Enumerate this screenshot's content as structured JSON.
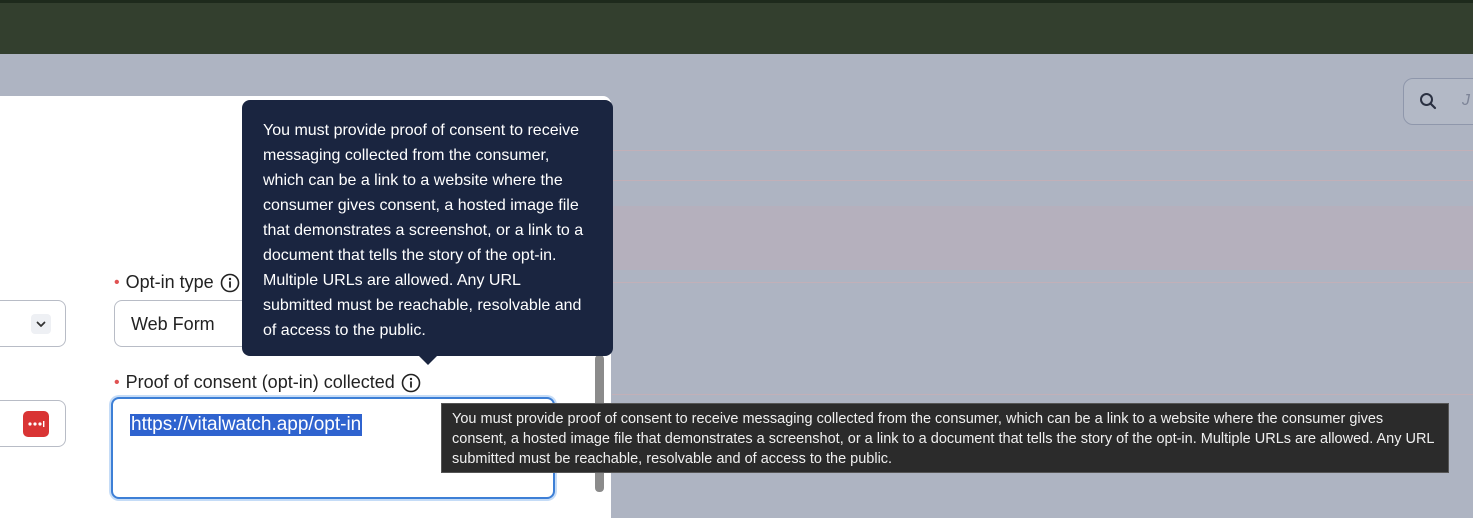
{
  "search": {
    "placeholder_partial": "J"
  },
  "form": {
    "optin_type": {
      "label": "Opt-in type",
      "value": "Web Form"
    },
    "proof": {
      "label": "Proof of consent (opt-in) collected",
      "value": "https://vitalwatch.app/opt-in"
    }
  },
  "popover": {
    "text": "You must provide proof of consent to receive messaging collected from the consumer, which can be a link to a website where the consumer gives consent, a hosted image file that demonstrates a screenshot, or a link to a document that tells the story of the opt-in. Multiple URLs are allowed. Any URL submitted must be reachable, resolvable and of access to the public."
  },
  "tooltip": {
    "text": "You must provide proof of consent to receive messaging collected from the consumer, which can be a link to a website where the consumer gives consent, a hosted image file that demonstrates a screenshot, or a link to a document that tells the story of the opt-in. Multiple URLs are allowed. Any URL submitted must be reachable, resolvable and of access to the public."
  },
  "colors": {
    "required": "#e05252",
    "popover_bg": "#1a2540",
    "focus": "#3d7fd6"
  }
}
